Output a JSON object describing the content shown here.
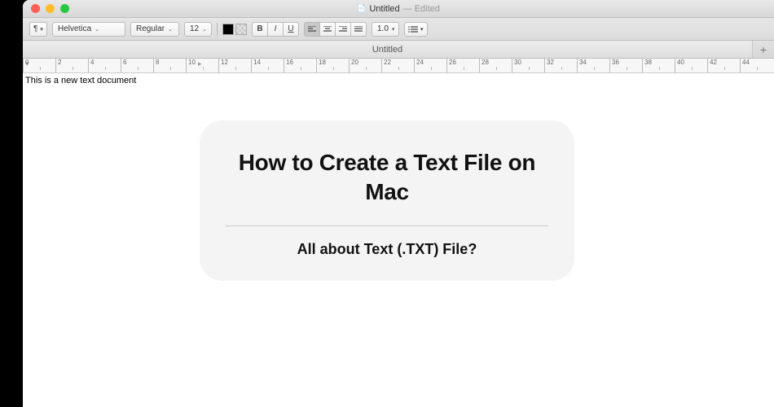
{
  "window": {
    "doc_name": "Untitled",
    "status": "Edited"
  },
  "toolbar": {
    "paragraph_style_label": "¶",
    "font_family": "Helvetica",
    "font_style": "Regular",
    "font_size": "12",
    "bold": "B",
    "italic": "I",
    "underline": "U",
    "line_spacing": "1.0"
  },
  "tabs": {
    "active": "Untitled",
    "plus": "+"
  },
  "ruler": {
    "units": [
      "0",
      "2",
      "4",
      "6",
      "8",
      "10",
      "12",
      "14",
      "16",
      "18",
      "20",
      "22",
      "24",
      "26",
      "28",
      "30",
      "32",
      "34",
      "36",
      "38",
      "40",
      "42",
      "44"
    ]
  },
  "document": {
    "body_text": "This is a new text document"
  },
  "overlay": {
    "headline": "How to Create a Text File on Mac",
    "subline": "All about Text (.TXT) File?"
  }
}
